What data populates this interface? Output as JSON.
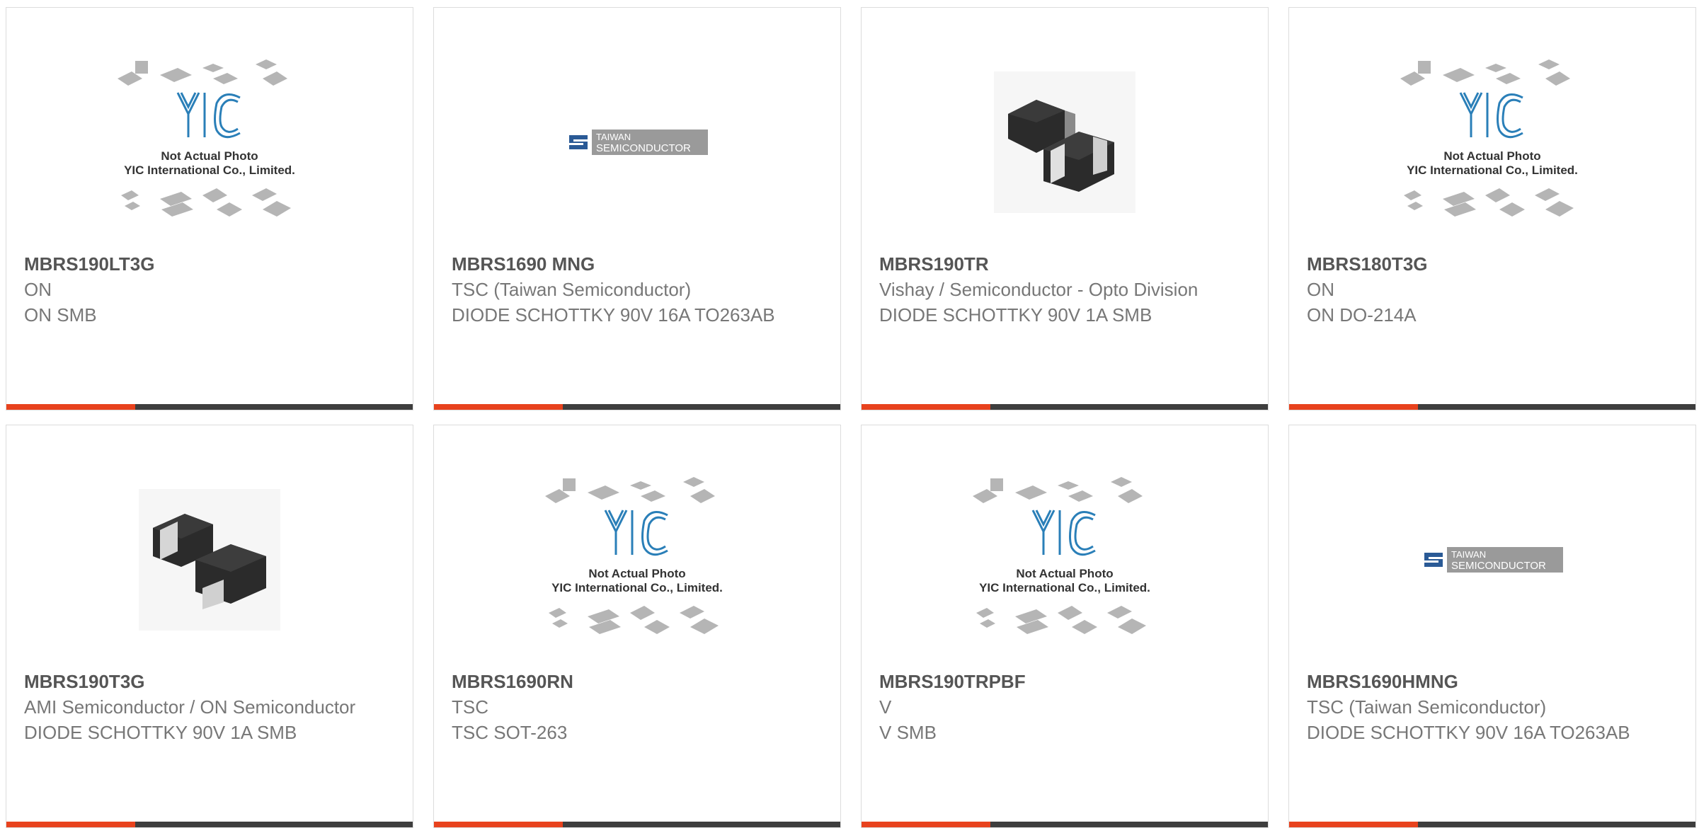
{
  "colors": {
    "accent": "#e8421d",
    "bar": "#3e3e3e",
    "border": "#dcdcdc",
    "part_text": "#555555",
    "body_text": "#777777",
    "yic_blue": "#2a7fb8",
    "tsc_blue": "#2a5a96",
    "tsc_gray": "#9a9a9a"
  },
  "placeholder": {
    "line1": "Not Actual Photo",
    "line2": "YIC International Co., Limited.",
    "logo": "YIC"
  },
  "tsc_logo": {
    "line1": "TAIWAN",
    "line2": "SEMICONDUCTOR"
  },
  "products": [
    {
      "part": "MBRS190LT3G",
      "maker": "ON",
      "desc": "ON SMB",
      "image": "yic-placeholder"
    },
    {
      "part": "MBRS1690 MNG",
      "maker": "TSC (Taiwan Semiconductor)",
      "desc": "DIODE SCHOTTKY 90V 16A TO263AB",
      "image": "tsc-logo"
    },
    {
      "part": "MBRS190TR",
      "maker": "Vishay / Semiconductor - Opto Division",
      "desc": "DIODE SCHOTTKY 90V 1A SMB",
      "image": "smb-diode-photo"
    },
    {
      "part": "MBRS180T3G",
      "maker": "ON",
      "desc": "ON DO-214A",
      "image": "yic-placeholder"
    },
    {
      "part": "MBRS190T3G",
      "maker": "AMI Semiconductor / ON Semiconductor",
      "desc": "DIODE SCHOTTKY 90V 1A SMB",
      "image": "smb-diode-photo"
    },
    {
      "part": "MBRS1690RN",
      "maker": "TSC",
      "desc": "TSC SOT-263",
      "image": "yic-placeholder"
    },
    {
      "part": "MBRS190TRPBF",
      "maker": "V",
      "desc": "V SMB",
      "image": "yic-placeholder"
    },
    {
      "part": "MBRS1690HMNG",
      "maker": "TSC (Taiwan Semiconductor)",
      "desc": "DIODE SCHOTTKY 90V 16A TO263AB",
      "image": "tsc-logo"
    }
  ]
}
